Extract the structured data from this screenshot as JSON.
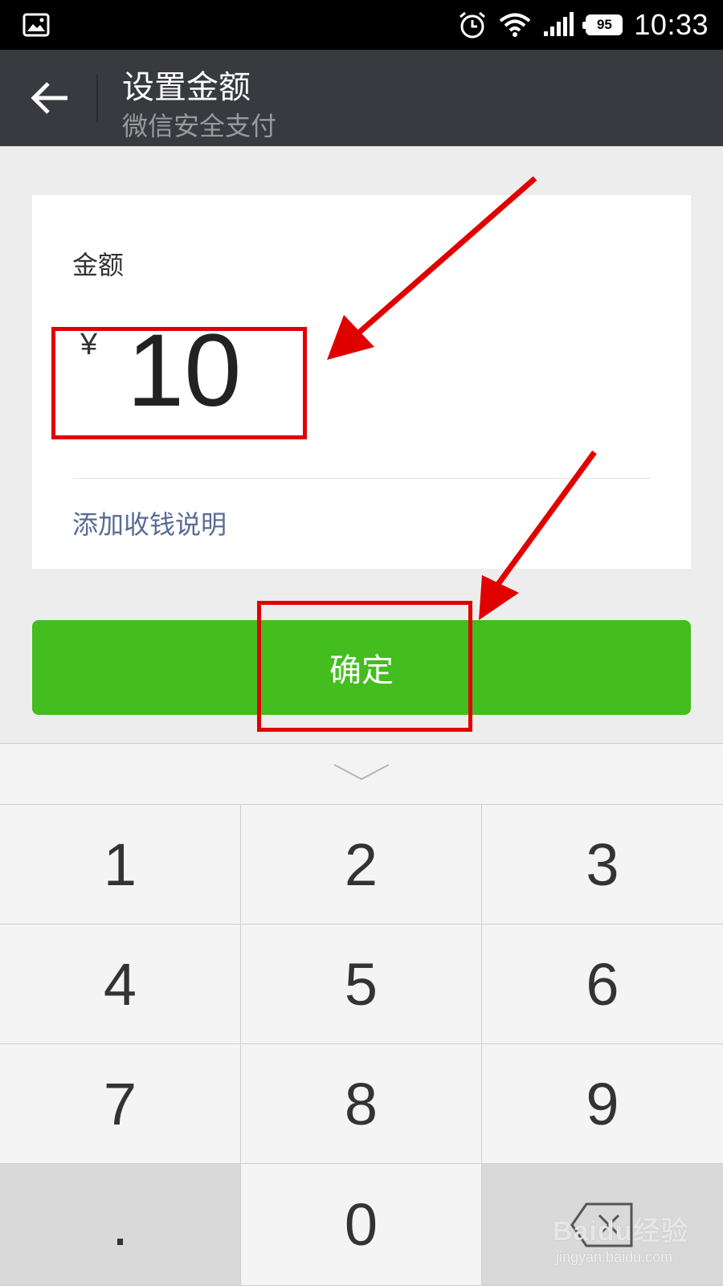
{
  "status_bar": {
    "time": "10:33",
    "battery": "95",
    "icons": [
      "gallery-icon",
      "alarm-icon",
      "wifi-icon",
      "signal-icon",
      "battery-icon"
    ]
  },
  "header": {
    "title": "设置金额",
    "subtitle": "微信安全支付",
    "back_icon": "back-arrow-icon",
    "background": "#393a3f"
  },
  "amount_card": {
    "label": "金额",
    "currency": "¥",
    "value": "10",
    "add_note": "添加收钱说明"
  },
  "confirm_button": {
    "label": "确定",
    "color": "#44bd1f"
  },
  "keypad": {
    "keys": [
      "1",
      "2",
      "3",
      "4",
      "5",
      "6",
      "7",
      "8",
      "9",
      ".",
      "0",
      ""
    ],
    "collapse_icon": "chevron-down-icon",
    "backspace_icon": "backspace-icon"
  },
  "watermark": {
    "logo": "Baidu经验",
    "url": "jingyan.baidu.com"
  },
  "annotation_color": "#e00000"
}
